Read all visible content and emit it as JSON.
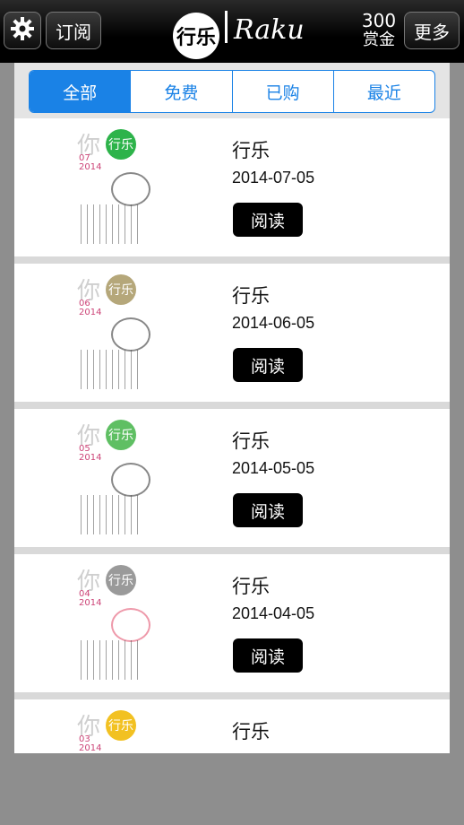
{
  "topbar": {
    "settings_icon": "gear-icon",
    "subscribe_label": "订阅",
    "logo_glyph": "行乐",
    "logo_word": "Raku",
    "bounty_value": "300",
    "bounty_label": "赏金",
    "more_label": "更多"
  },
  "tabs": [
    {
      "label": "全部",
      "active": true
    },
    {
      "label": "免费",
      "active": false
    },
    {
      "label": "已购",
      "active": false
    },
    {
      "label": "最近",
      "active": false
    }
  ],
  "colors": {
    "accent": "#1a82e6"
  },
  "issues": [
    {
      "title": "行乐",
      "date": "2014-07-05",
      "read_label": "阅读",
      "cover_badge": "行乐",
      "cover_mark": "你",
      "cover_issue": "07",
      "cover_year": "2014",
      "cover_color": "#2db34a"
    },
    {
      "title": "行乐",
      "date": "2014-06-05",
      "read_label": "阅读",
      "cover_badge": "行乐",
      "cover_mark": "你",
      "cover_issue": "06",
      "cover_year": "2014",
      "cover_color": "#b5a77a"
    },
    {
      "title": "行乐",
      "date": "2014-05-05",
      "read_label": "阅读",
      "cover_badge": "行乐",
      "cover_mark": "你",
      "cover_issue": "05",
      "cover_year": "2014",
      "cover_color": "#5fbf63"
    },
    {
      "title": "行乐",
      "date": "2014-04-05",
      "read_label": "阅读",
      "cover_badge": "行乐",
      "cover_mark": "你",
      "cover_issue": "04",
      "cover_year": "2014",
      "cover_color": "#9a9a9a"
    },
    {
      "title": "行乐",
      "date": "",
      "read_label": "",
      "cover_badge": "行乐",
      "cover_mark": "你",
      "cover_issue": "03",
      "cover_year": "2014",
      "cover_color": "#f2c122"
    }
  ]
}
